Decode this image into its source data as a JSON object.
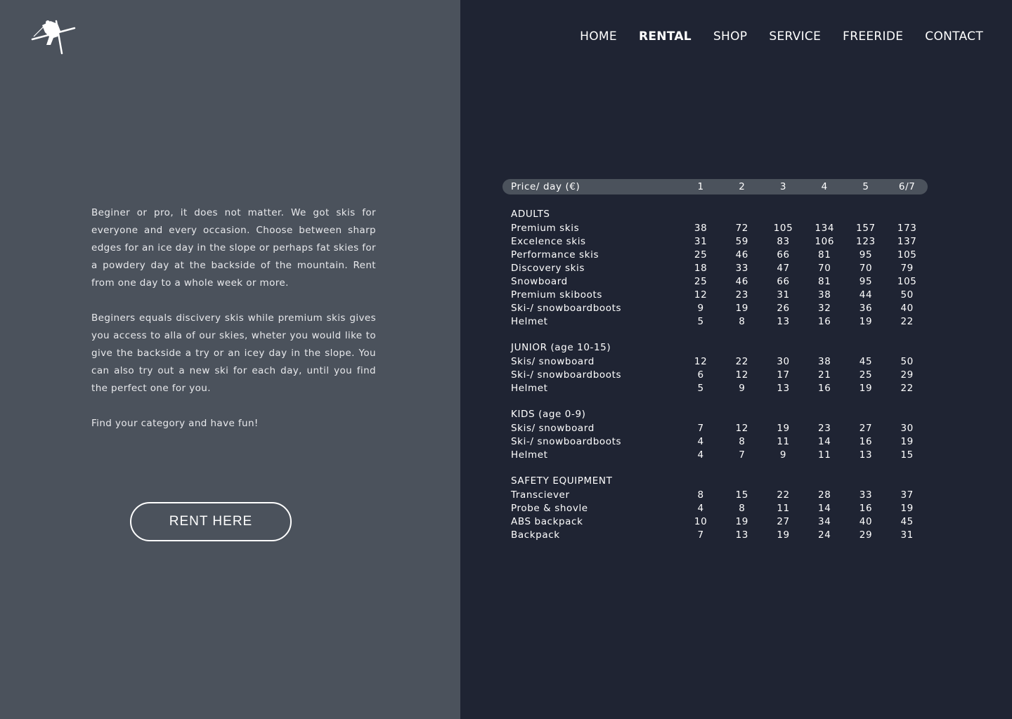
{
  "nav": {
    "items": [
      {
        "label": "HOME",
        "active": false
      },
      {
        "label": "RENTAL",
        "active": true
      },
      {
        "label": "SHOP",
        "active": false
      },
      {
        "label": "SERVICE",
        "active": false
      },
      {
        "label": "FREERIDE",
        "active": false
      },
      {
        "label": "CONTACT",
        "active": false
      }
    ]
  },
  "logo": {
    "icon": "skier-icon"
  },
  "intro": {
    "paragraphs": [
      "Beginer or pro, it does not matter. We got skis for everyone and every occasion. Choose between sharp edges for an ice day in the slope or perhaps  fat skies for a powdery day  at the backside of the mountain.  Rent from one day to a whole week or more.",
      "Beginers equals discivery skis while premium skis gives you access to alla of our skies, wheter you would like to give the backside a try or an icey day in the slope. You can also  try out a new ski for each day, until you find the perfect one for you.",
      "Find your category and have fun!"
    ]
  },
  "cta": {
    "label": "RENT HERE"
  },
  "price_table": {
    "header": {
      "label": "Price/ day (€)",
      "days": [
        "1",
        "2",
        "3",
        "4",
        "5",
        "6/7"
      ]
    },
    "sections": [
      {
        "title": "ADULTS",
        "rows": [
          {
            "label": "Premium skis",
            "values": [
              "38",
              "72",
              "105",
              "134",
              "157",
              "173"
            ]
          },
          {
            "label": "Excelence skis",
            "values": [
              "31",
              "59",
              "83",
              "106",
              "123",
              "137"
            ]
          },
          {
            "label": "Performance skis",
            "values": [
              "25",
              "46",
              "66",
              "81",
              "95",
              "105"
            ]
          },
          {
            "label": "Discovery skis",
            "values": [
              "18",
              "33",
              "47",
              "70",
              "70",
              "79"
            ]
          },
          {
            "label": "Snowboard",
            "values": [
              "25",
              "46",
              "66",
              "81",
              "95",
              "105"
            ]
          },
          {
            "label": "Premium skiboots",
            "values": [
              "12",
              "23",
              "31",
              "38",
              "44",
              "50"
            ]
          },
          {
            "label": "Ski-/ snowboardboots",
            "values": [
              "9",
              "19",
              "26",
              "32",
              "36",
              "40"
            ]
          },
          {
            "label": "Helmet",
            "values": [
              "5",
              "8",
              "13",
              "16",
              "19",
              "22"
            ]
          }
        ]
      },
      {
        "title": "JUNIOR (age 10-15)",
        "rows": [
          {
            "label": "Skis/ snowboard",
            "values": [
              "12",
              "22",
              "30",
              "38",
              "45",
              "50"
            ]
          },
          {
            "label": "Ski-/ snowboardboots",
            "values": [
              "6",
              "12",
              "17",
              "21",
              "25",
              "29"
            ]
          },
          {
            "label": "Helmet",
            "values": [
              "5",
              "9",
              "13",
              "16",
              "19",
              "22"
            ]
          }
        ]
      },
      {
        "title": "KIDS (age 0-9)",
        "rows": [
          {
            "label": "Skis/ snowboard",
            "values": [
              "7",
              "12",
              "19",
              "23",
              "27",
              "30"
            ]
          },
          {
            "label": "Ski-/ snowboardboots",
            "values": [
              "4",
              "8",
              "11",
              "14",
              "16",
              "19"
            ]
          },
          {
            "label": "Helmet",
            "values": [
              "4",
              "7",
              "9",
              "11",
              "13",
              "15"
            ]
          }
        ]
      },
      {
        "title": "SAFETY EQUIPMENT",
        "rows": [
          {
            "label": "Transciever",
            "values": [
              "8",
              "15",
              "22",
              "28",
              "33",
              "37"
            ]
          },
          {
            "label": "Probe & shovle",
            "values": [
              "4",
              "8",
              "11",
              "14",
              "16",
              "19"
            ]
          },
          {
            "label": "ABS backpack",
            "values": [
              "10",
              "19",
              "27",
              "34",
              "40",
              "45"
            ]
          },
          {
            "label": "Backpack",
            "values": [
              "7",
              "13",
              "19",
              "24",
              "29",
              "31"
            ]
          }
        ]
      }
    ]
  }
}
